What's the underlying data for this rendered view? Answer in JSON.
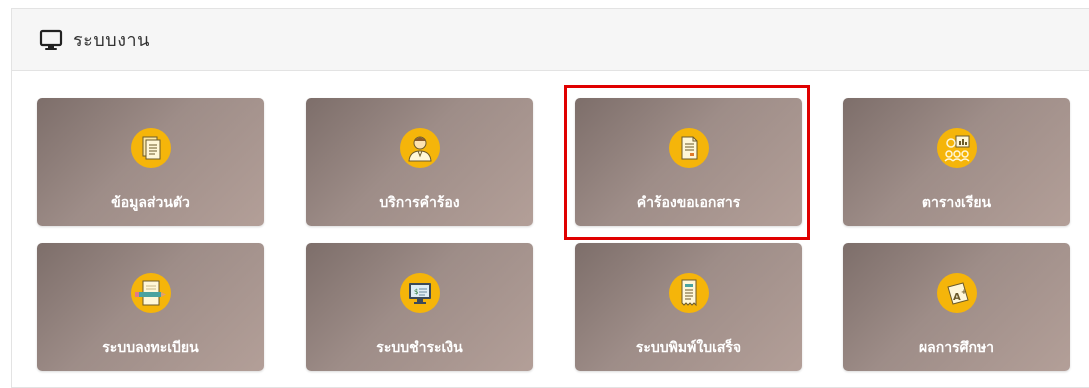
{
  "panel": {
    "title": "ระบบงาน",
    "title_icon": "monitor-icon"
  },
  "tiles": [
    {
      "label": "ข้อมูลส่วนตัว",
      "icon": "profile-document-icon"
    },
    {
      "label": "บริการคำร้อง",
      "icon": "student-person-icon"
    },
    {
      "label": "คำร้องขอเอกสาร",
      "icon": "document-request-icon"
    },
    {
      "label": "ตารางเรียน",
      "icon": "class-schedule-icon"
    },
    {
      "label": "ระบบลงทะเบียน",
      "icon": "registration-icon"
    },
    {
      "label": "ระบบชำระเงิน",
      "icon": "payment-monitor-icon"
    },
    {
      "label": "ระบบพิมพ์ใบเสร็จ",
      "icon": "receipt-icon"
    },
    {
      "label": "ผลการศึกษา",
      "icon": "grade-board-icon"
    }
  ],
  "colors": {
    "tile_gradient_start": "#7d6e6a",
    "tile_gradient_end": "#b39f98",
    "icon_circle": "#f5b50a",
    "highlight": "#e00000"
  }
}
